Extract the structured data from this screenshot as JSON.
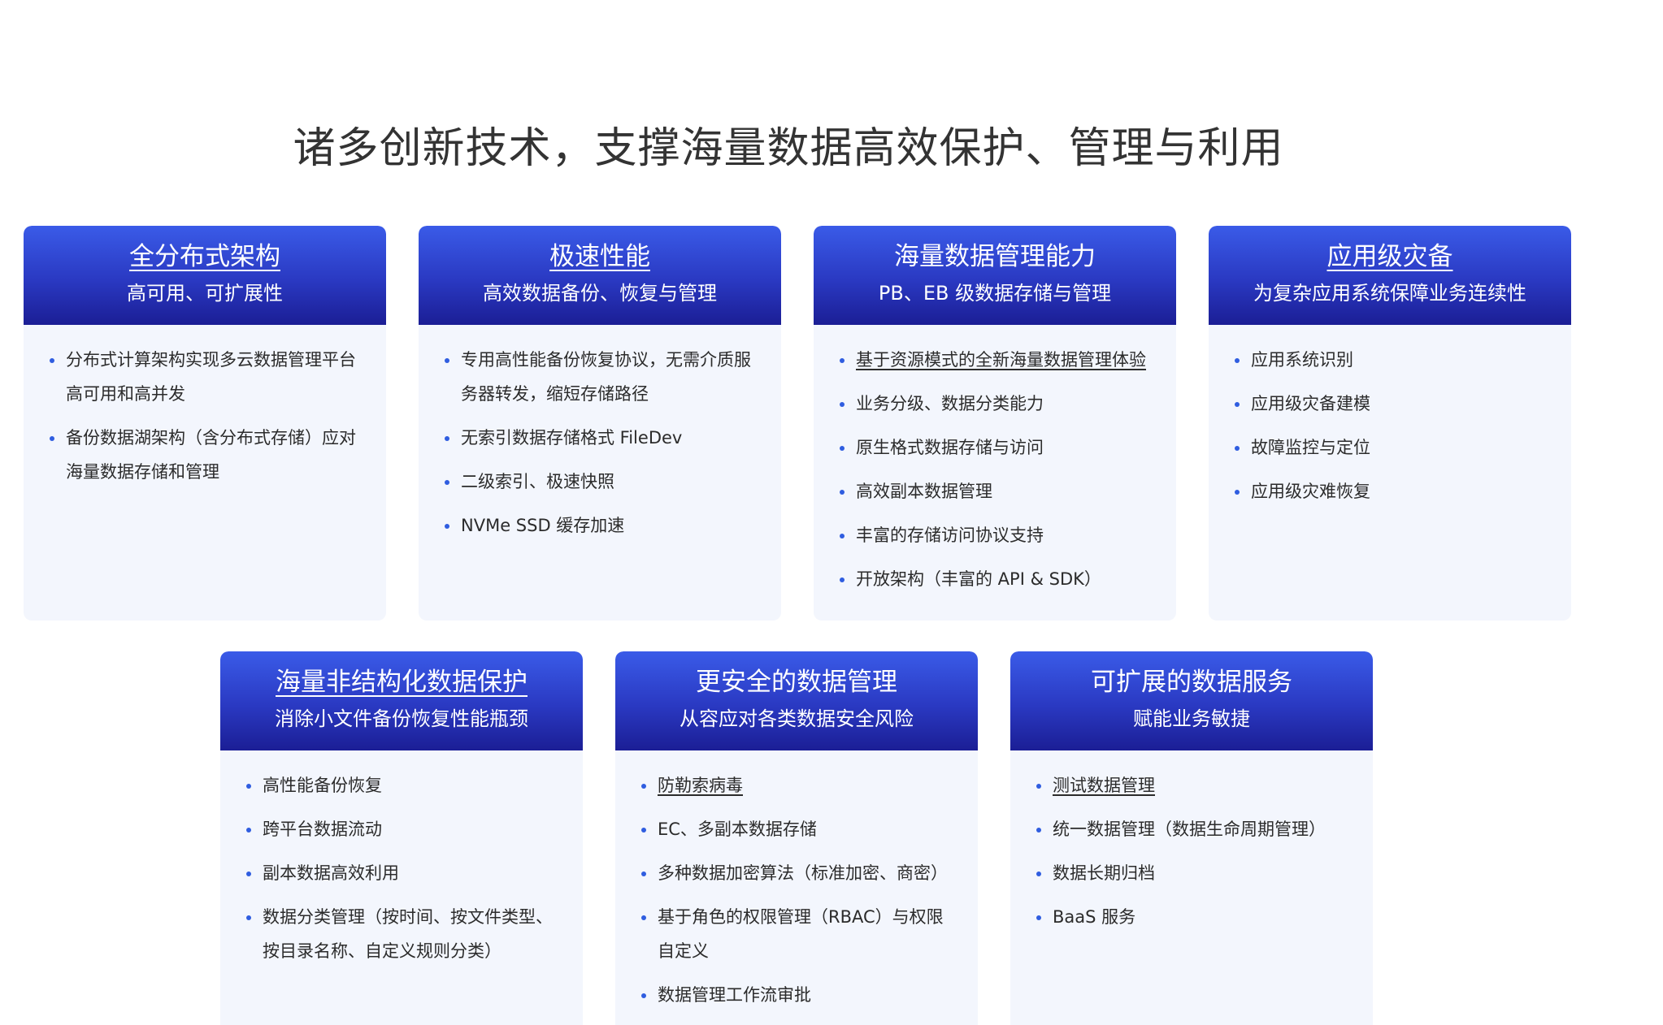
{
  "page_title": "诸多创新技术，支撑海量数据高效保护、管理与利用",
  "cards": [
    {
      "title": "全分布式架构",
      "subtitle": "高可用、可扩展性",
      "items": [
        "分布式计算架构实现多云数据管理平台高可用和高并发",
        "备份数据湖架构（含分布式存储）应对海量数据存储和管理"
      ]
    },
    {
      "title": "极速性能",
      "subtitle": "高效数据备份、恢复与管理",
      "items": [
        "专用高性能备份恢复协议，无需介质服务器转发，缩短存储路径",
        "无索引数据存储格式 FileDev",
        "二级索引、极速快照",
        "NVMe SSD 缓存加速"
      ]
    },
    {
      "title": "海量数据管理能力",
      "subtitle": "PB、EB 级数据存储与管理",
      "items": [
        "基于资源模式的全新海量数据管理体验",
        "业务分级、数据分类能力",
        "原生格式数据存储与访问",
        "高效副本数据管理",
        "丰富的存储访问协议支持",
        "开放架构（丰富的 API & SDK）"
      ]
    },
    {
      "title": "应用级灾备",
      "subtitle": "为复杂应用系统保障业务连续性",
      "items": [
        "应用系统识别",
        "应用级灾备建模",
        "故障监控与定位",
        "应用级灾难恢复"
      ]
    },
    {
      "title": "海量非结构化数据保护",
      "subtitle": "消除小文件备份恢复性能瓶颈",
      "items": [
        "高性能备份恢复",
        "跨平台数据流动",
        "副本数据高效利用",
        "数据分类管理（按时间、按文件类型、按目录名称、自定义规则分类）"
      ]
    },
    {
      "title": "更安全的数据管理",
      "subtitle": "从容应对各类数据安全风险",
      "items": [
        "防勒索病毒",
        "EC、多副本数据存储",
        "多种数据加密算法（标准加密、商密）",
        "基于角色的权限管理（RBAC）与权限自定义",
        "数据管理工作流审批"
      ]
    },
    {
      "title": "可扩展的数据服务",
      "subtitle": "赋能业务敏捷",
      "items": [
        "测试数据管理",
        "统一数据管理（数据生命周期管理）",
        "数据长期归档",
        "BaaS 服务"
      ]
    }
  ]
}
